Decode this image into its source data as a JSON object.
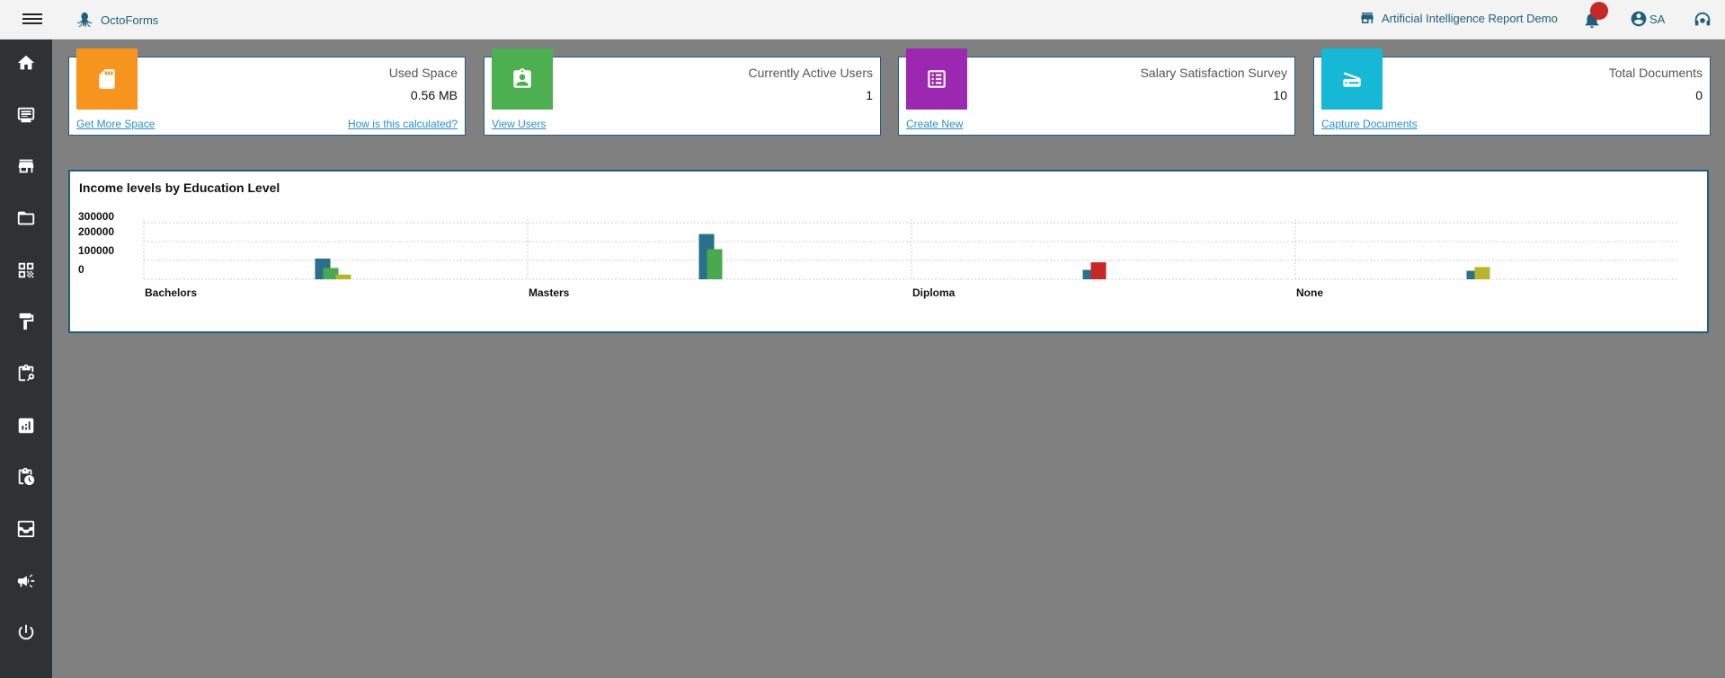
{
  "app": {
    "name": "OctoForms"
  },
  "header": {
    "organization": "Artificial Intelligence Report Demo",
    "user_initials": "SA"
  },
  "sidebar": {
    "items": [
      {
        "icon": "home-icon"
      },
      {
        "icon": "forms-icon"
      },
      {
        "icon": "store-icon"
      },
      {
        "icon": "folder-icon"
      },
      {
        "icon": "qr-code-icon"
      },
      {
        "icon": "paint-roller-icon"
      },
      {
        "icon": "clipboard-search-icon"
      },
      {
        "icon": "analytics-icon"
      },
      {
        "icon": "clipboard-clock-icon"
      },
      {
        "icon": "inbox-icon"
      },
      {
        "icon": "campaign-icon"
      },
      {
        "icon": "power-icon"
      }
    ]
  },
  "cards": [
    {
      "title": "Used Space",
      "value": "0.56 MB",
      "link": "Get More Space",
      "link2": "How is this calculated?",
      "color": "#f7941d",
      "icon": "sd-card-icon"
    },
    {
      "title": "Currently Active Users",
      "value": "1",
      "link": "View Users",
      "color": "#4caf50",
      "icon": "user-badge-icon"
    },
    {
      "title": "Salary Satisfaction Survey",
      "value": "10",
      "link": "Create New",
      "color": "#9c27b0",
      "icon": "list-form-icon"
    },
    {
      "title": "Total Documents",
      "value": "0",
      "link": "Capture Documents",
      "color": "#17b8d6",
      "icon": "scanner-icon"
    }
  ],
  "chart_data": {
    "type": "bar",
    "title": "Income levels by Education Level",
    "categories": [
      "Bachelors",
      "Masters",
      "Diploma",
      "None"
    ],
    "ylim": [
      0,
      300000
    ],
    "yticks": [
      0,
      100000,
      200000,
      300000
    ],
    "grid": true,
    "series": [
      {
        "color": "#2a6f8c",
        "values": [
          110000,
          240000,
          50000,
          45000
        ]
      },
      {
        "color": "#4aa84e",
        "values": [
          60000,
          160000,
          0,
          0
        ]
      },
      {
        "color": "#b7b52a",
        "values": [
          25000,
          0,
          0,
          65000
        ]
      },
      {
        "color": "#c62828",
        "values": [
          0,
          0,
          90000,
          0
        ]
      }
    ]
  }
}
